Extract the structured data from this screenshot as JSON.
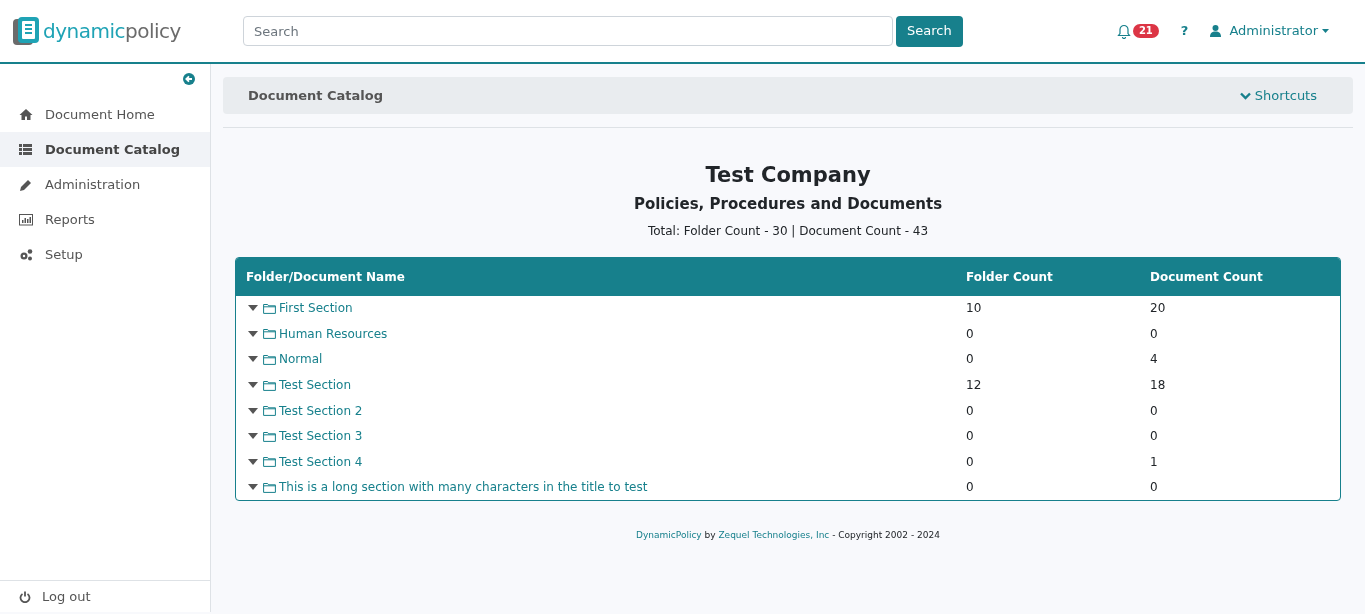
{
  "logo": {
    "part_1": "dynamic",
    "part_2": "policy"
  },
  "search": {
    "placeholder": "Search",
    "button": "Search"
  },
  "header": {
    "notifications": "21",
    "help": "?",
    "user": "Administrator"
  },
  "sidebar": {
    "items": [
      {
        "kind": "home",
        "label": "Document Home",
        "selected": false
      },
      {
        "kind": "list",
        "label": "Document Catalog",
        "selected": true
      },
      {
        "kind": "pencil",
        "label": "Administration",
        "selected": false
      },
      {
        "kind": "chart",
        "label": "Reports",
        "selected": false
      },
      {
        "kind": "gears",
        "label": "Setup",
        "selected": false
      }
    ],
    "logout": "Log out"
  },
  "breadcrumb": {
    "title": "Document Catalog",
    "shortcuts": "Shortcuts"
  },
  "report": {
    "company": "Test Company",
    "subtitle": "Policies, Procedures and Documents",
    "totals": "Total: Folder Count - 30 | Document Count - 43"
  },
  "table": {
    "columns": [
      "Folder/Document Name",
      "Folder Count",
      "Document Count"
    ],
    "rows": [
      {
        "name": "First Section",
        "folders": "10",
        "documents": "20"
      },
      {
        "name": "Human Resources",
        "folders": "0",
        "documents": "0"
      },
      {
        "name": "Normal",
        "folders": "0",
        "documents": "4"
      },
      {
        "name": "Test Section",
        "folders": "12",
        "documents": "18"
      },
      {
        "name": "Test Section 2",
        "folders": "0",
        "documents": "0"
      },
      {
        "name": "Test Section 3",
        "folders": "0",
        "documents": "0"
      },
      {
        "name": "Test Section 4",
        "folders": "0",
        "documents": "1"
      },
      {
        "name": "This is a long section with many characters in the title to test",
        "folders": "0",
        "documents": "0"
      }
    ]
  },
  "footer": {
    "product_link": "DynamicPolicy",
    "by": "by",
    "company_link": "Zequel Technologies, Inc",
    "copyright": "- Copyright 2002 - 2024"
  }
}
